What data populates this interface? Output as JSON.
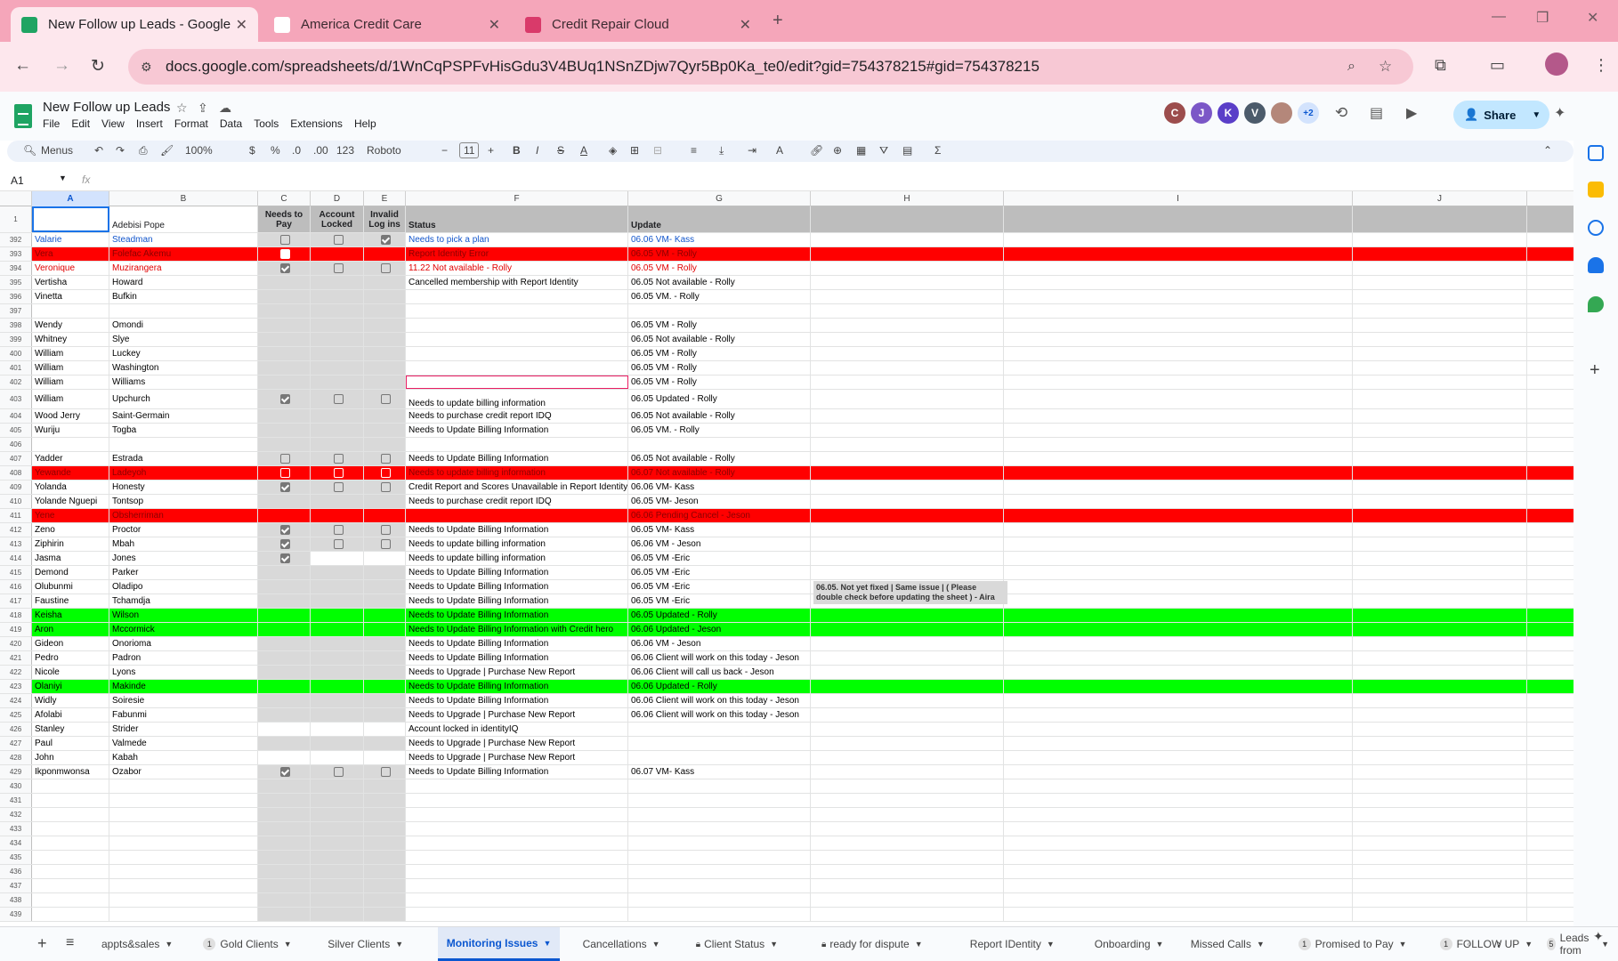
{
  "browser": {
    "tabs": [
      {
        "title": "New Follow up Leads - Google",
        "active": true,
        "fav": "sheets-icon",
        "color": "#1fa463"
      },
      {
        "title": "America Credit Care",
        "active": false,
        "fav": "page-icon",
        "color": "#ffffff"
      },
      {
        "title": "Credit Repair Cloud",
        "active": false,
        "fav": "cloud-icon",
        "color": "#d93a6a"
      }
    ],
    "new_tab": "+",
    "url": "docs.google.com/spreadsheets/d/1WnCqPSPFvHisGdu3V4BUq1NSnZDjw7Qyr5Bp0Ka_te0/edit?gid=754378215#gid=754378215"
  },
  "sheets": {
    "doc_title": "New Follow up Leads",
    "menus": [
      "File",
      "Edit",
      "View",
      "Insert",
      "Format",
      "Data",
      "Tools",
      "Extensions",
      "Help"
    ],
    "avatars": [
      {
        "l": "C",
        "c": "#9c4d4d"
      },
      {
        "l": "J",
        "c": "#7b57c7"
      },
      {
        "l": "K",
        "c": "#5a3ec8"
      },
      {
        "l": "V",
        "c": "#4c5b6b"
      },
      {
        "l": "",
        "c": "#b4877a"
      },
      {
        "l": "+2",
        "c": "#d3e3fd"
      }
    ],
    "share_label": "Share",
    "toolbar": {
      "menus": "Menus",
      "zoom": "100%",
      "dollar": "$",
      "percent": "%",
      "dec_less": ".0",
      "dec_more": ".00",
      "num": "123",
      "font": "Roboto",
      "size": "11",
      "bold": "B",
      "italic": "I",
      "strike": "S",
      "color_a": "A",
      "sigma": "Σ"
    },
    "cell_ref": "A1",
    "fx": "fx"
  },
  "columns": [
    {
      "l": "A",
      "w": 87,
      "sel": true
    },
    {
      "l": "B",
      "w": 167
    },
    {
      "l": "C",
      "w": 59
    },
    {
      "l": "D",
      "w": 60
    },
    {
      "l": "E",
      "w": 47
    },
    {
      "l": "F",
      "w": 250
    },
    {
      "l": "G",
      "w": 205
    },
    {
      "l": "H",
      "w": 217
    },
    {
      "l": "I",
      "w": 392
    },
    {
      "l": "J",
      "w": 196
    }
  ],
  "header_row": {
    "num": "1",
    "a": "",
    "b": "Adebisi Pope",
    "c": "Needs to Pay",
    "d": "Account Locked",
    "e": "Invalid Log ins",
    "f": "Status",
    "g": "Update"
  },
  "rows": [
    {
      "n": "392",
      "a": "Valarie",
      "b": "Steadman",
      "c": 0,
      "d": 0,
      "e": 1,
      "f": "Needs to pick a plan",
      "g": "06.06 VM- Kass",
      "color": "blue"
    },
    {
      "n": "393",
      "a": "Vera",
      "b": "Folefac Akemu",
      "c": 1,
      "f": "Report Identity Error",
      "g": "06.05 VM - Rolly",
      "style": "red"
    },
    {
      "n": "394",
      "a": "Veronique",
      "b": "Muzirangera",
      "c": 1,
      "d": 0,
      "e": 0,
      "f": "11.22 Not available - Rolly",
      "g": "06.05 VM - Rolly",
      "color": "red"
    },
    {
      "n": "395",
      "a": "Vertisha",
      "b": "Howard",
      "f": "Cancelled membership with Report Identity",
      "g": "06.05 Not available - Rolly"
    },
    {
      "n": "396",
      "a": "Vinetta",
      "b": "Bufkin",
      "g": "06.05 VM. - Rolly"
    },
    {
      "n": "397"
    },
    {
      "n": "398",
      "a": "Wendy",
      "b": "Omondi",
      "g": "06.05 VM - Rolly"
    },
    {
      "n": "399",
      "a": "Whitney",
      "b": "Slye",
      "g": "06.05 Not available - Rolly"
    },
    {
      "n": "400",
      "a": "William",
      "b": "Luckey",
      "g": "06.05 VM - Rolly"
    },
    {
      "n": "401",
      "a": "William",
      "b": "Washington",
      "g": "06.05 VM - Rolly"
    },
    {
      "n": "402",
      "a": "William",
      "b": "Williams",
      "g": "06.05 VM  - Rolly",
      "fsel": true
    },
    {
      "n": "403",
      "a": "William",
      "b": "Upchurch",
      "c": 1,
      "d": 0,
      "e": 0,
      "f": "Needs to update billing information",
      "g": "06.05 Updated - Rolly",
      "tall": true
    },
    {
      "n": "404",
      "a": "Wood Jerry",
      "b": "Saint-Germain",
      "f": "Needs to purchase credit report IDQ",
      "g": "06.05 Not available - Rolly"
    },
    {
      "n": "405",
      "a": "Wuriju",
      "b": "Togba",
      "f": "Needs to Update Billing Information",
      "g": "06.05 VM. - Rolly"
    },
    {
      "n": "406"
    },
    {
      "n": "407",
      "a": "Yadder",
      "b": "Estrada",
      "c": 0,
      "d": 0,
      "e": 0,
      "f": "Needs to Update Billing Information",
      "g": "06.05 Not available - Rolly"
    },
    {
      "n": "408",
      "a": "Yewande",
      "b": "Ladeyoh",
      "c": 0,
      "d": 0,
      "e": 0,
      "f": "Needs to update billing information",
      "g": "06.07 Not available - Rolly",
      "style": "red"
    },
    {
      "n": "409",
      "a": "Yolanda",
      "b": "Honesty",
      "c": 1,
      "d": 0,
      "e": 0,
      "f": "Credit Report and Scores Unavailable in Report Identity",
      "g": "06.06 VM- Kass"
    },
    {
      "n": "410",
      "a": "Yolande Nguepi",
      "b": "Tontsop",
      "f": "Needs to purchase credit report IDQ",
      "g": "06.05 VM- Jeson"
    },
    {
      "n": "411",
      "a": "Yene",
      "b": "Obsherriman",
      "g": "06.06 Pending Cancel - Jeson",
      "style": "red"
    },
    {
      "n": "412",
      "a": "Zeno",
      "b": "Proctor",
      "c": 1,
      "d": 0,
      "e": 0,
      "f": "Needs to Update Billing Information",
      "g": "06.05 VM- Kass"
    },
    {
      "n": "413",
      "a": "Ziphirin",
      "b": "Mbah",
      "c": 1,
      "d": 0,
      "e": 0,
      "f": "Needs to update billing information",
      "g": "06.06 VM - Jeson"
    },
    {
      "n": "414",
      "a": "Jasma",
      "b": "Jones",
      "c": 1,
      "f": "Needs to update billing information",
      "g": "06.05 VM -Eric",
      "whitede": true
    },
    {
      "n": "415",
      "a": "Demond",
      "b": "Parker",
      "f": "Needs to Update Billing Information",
      "g": "06.05 VM -Eric"
    },
    {
      "n": "416",
      "a": "Olubunmi",
      "b": "Oladipo",
      "f": "Needs to Update Billing Information",
      "g": "06.05 VM -Eric"
    },
    {
      "n": "417",
      "a": "Faustine",
      "b": "Tchamdja",
      "f": "Needs to Update Billing Information",
      "g": "06.05 VM -Eric"
    },
    {
      "n": "418",
      "a": "Keisha",
      "b": "Wilson",
      "f": "Needs to Update Billing Information",
      "g": "06.05 Updated - Rolly",
      "style": "green"
    },
    {
      "n": "419",
      "a": "Aron",
      "b": "Mccormick",
      "f": "Needs to Update Billing Information with Credit hero",
      "g": "06.06 Updated - Jeson",
      "style": "green"
    },
    {
      "n": "420",
      "a": "Gideon",
      "b": " Onorioma",
      "f": "Needs to Update Billing Information",
      "g": "06.06 VM - Jeson"
    },
    {
      "n": "421",
      "a": "Pedro",
      "b": "Padron",
      "f": "Needs to Update Billing Information",
      "g": "06.06 Client will work on this today - Jeson"
    },
    {
      "n": "422",
      "a": "Nicole",
      "b": "Lyons",
      "f": "Needs to Upgrade | Purchase New Report",
      "g": "06.06 Client will call us back - Jeson"
    },
    {
      "n": "423",
      "a": "Olaniyi",
      "b": "Makinde",
      "f": "Needs to Update Billing Information",
      "g": "06.06 Updated - Rolly",
      "style": "green"
    },
    {
      "n": "424",
      "a": "Widly",
      "b": "Soiresie",
      "f": "Needs to Update Billing Information",
      "g": "06.06 Client will work on this today - Jeson"
    },
    {
      "n": "425",
      "a": "Afolabi",
      "b": "Fabunmi",
      "f": "Needs to Upgrade | Purchase New Report",
      "g": "06.06 Client will work on this today - Jeson"
    },
    {
      "n": "426",
      "a": "Stanley",
      "b": "Strider",
      "f": "Account locked in identityIQ",
      "whitecde": true
    },
    {
      "n": "427",
      "a": "Paul",
      "b": "Valmede",
      "f": "Needs to Upgrade | Purchase New Report"
    },
    {
      "n": "428",
      "a": "John",
      "b": "Kabah",
      "f": "Needs to Upgrade | Purchase New Report",
      "whitecde": true
    },
    {
      "n": "429",
      "a": "Ikponmwonsa",
      "b": "Ozabor",
      "c": 1,
      "d": 0,
      "e": 0,
      "f": "Needs to Update Billing Information",
      "g": "06.07 VM- Kass"
    },
    {
      "n": "430"
    },
    {
      "n": "431"
    },
    {
      "n": "432"
    },
    {
      "n": "433"
    },
    {
      "n": "434"
    },
    {
      "n": "435"
    },
    {
      "n": "436"
    },
    {
      "n": "437"
    },
    {
      "n": "438"
    },
    {
      "n": "439"
    }
  ],
  "note_h403": "06.05. Not yet fixed | Same issue | ( Please double check before updating the sheet ) - Aira",
  "sheet_tabs": [
    {
      "label": "appts&sales"
    },
    {
      "label": "Gold Clients",
      "badge": "1"
    },
    {
      "label": "Silver Clients"
    },
    {
      "label": "Monitoring Issues",
      "active": true
    },
    {
      "label": "Cancellations"
    },
    {
      "label": "Client Status",
      "lock": true
    },
    {
      "label": "ready for dispute",
      "lock": true
    },
    {
      "label": "Report IDentity"
    },
    {
      "label": "Onboarding"
    },
    {
      "label": "Missed Calls"
    },
    {
      "label": "Promised to Pay",
      "badge": "1"
    },
    {
      "label": "FOLLOW UP",
      "badge": "1"
    },
    {
      "label": "Leads from",
      "badge": "5"
    }
  ]
}
